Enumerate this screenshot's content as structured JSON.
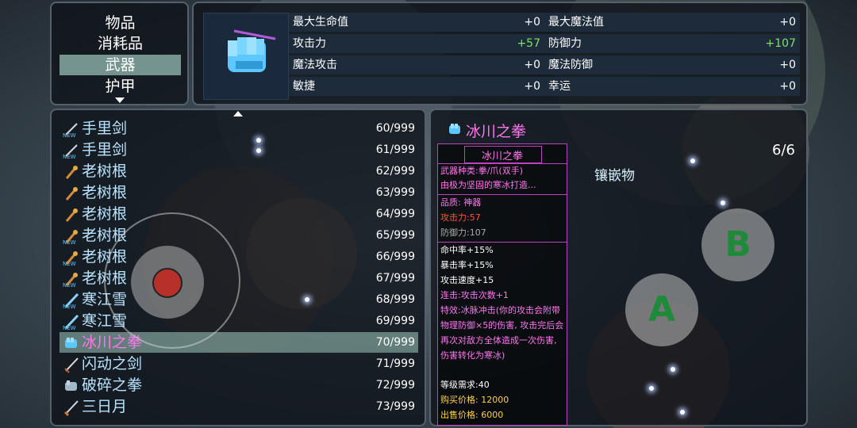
{
  "categories": [
    "物品",
    "消耗品",
    "武器",
    "护甲"
  ],
  "selected_category": 2,
  "stats": {
    "left": [
      {
        "name": "最大生命值",
        "value": "+0"
      },
      {
        "name": "攻击力",
        "value": "+57"
      },
      {
        "name": "魔法攻击",
        "value": "+0"
      },
      {
        "name": "敏捷",
        "value": "+0"
      }
    ],
    "right": [
      {
        "name": "最大魔法值",
        "value": "+0"
      },
      {
        "name": "防御力",
        "value": "+107"
      },
      {
        "name": "魔法防御",
        "value": "+0"
      },
      {
        "name": "幸运",
        "value": "+0"
      }
    ]
  },
  "items": [
    {
      "name": "手里剑",
      "count": "60/999",
      "icon": "shuriken-new-icon"
    },
    {
      "name": "手里剑",
      "count": "61/999",
      "icon": "shuriken-new-icon"
    },
    {
      "name": "老树根",
      "count": "62/999",
      "icon": "staff-icon"
    },
    {
      "name": "老树根",
      "count": "63/999",
      "icon": "staff-icon"
    },
    {
      "name": "老树根",
      "count": "64/999",
      "icon": "staff-icon"
    },
    {
      "name": "老树根",
      "count": "65/999",
      "icon": "staff-new-icon"
    },
    {
      "name": "老树根",
      "count": "66/999",
      "icon": "staff-new-icon"
    },
    {
      "name": "老树根",
      "count": "67/999",
      "icon": "staff-new-icon"
    },
    {
      "name": "寒江雪",
      "count": "68/999",
      "icon": "sword-new-icon"
    },
    {
      "name": "寒江雪",
      "count": "69/999",
      "icon": "sword-new-icon"
    },
    {
      "name": "冰川之拳",
      "count": "70/999",
      "icon": "ice-fist-icon"
    },
    {
      "name": "闪动之剑",
      "count": "71/999",
      "icon": "sword-icon"
    },
    {
      "name": "破碎之拳",
      "count": "72/999",
      "icon": "fist-icon"
    },
    {
      "name": "三日月",
      "count": "73/999",
      "icon": "blade-icon"
    }
  ],
  "selected_item": 10,
  "detail": {
    "title": "冰川之拳",
    "slots": "6/6",
    "inlay_label": "镶嵌物",
    "tooltip": {
      "name": "冰川之拳",
      "type": "武器种类:拳/爪(双手)",
      "desc": "由极为坚固的寒冰打造...",
      "quality": "品质: 神器",
      "atk": "攻击力:57",
      "def": "防御力:107",
      "hit": "命中率+15%",
      "crit": "暴击率+15%",
      "speed": "攻击速度+15",
      "combo": "连击:攻击次数+1",
      "special": "特效:冰脉冲击(你的攻击会附带物理防御×5的伤害, 攻击完后会再次对敌方全体造成一次伤害, 伤害转化为寒冰)",
      "level": "等级需求:40",
      "buy": "购买价格: 12000",
      "sell": "出售价格: 6000"
    }
  },
  "controls": {
    "b": "B",
    "a": "A"
  },
  "colors": {
    "item_name": "#b9e4ff",
    "selected_name": "#ff77ee",
    "stat_positive": "#7ee06a",
    "tooltip_border": "#c040c0"
  }
}
